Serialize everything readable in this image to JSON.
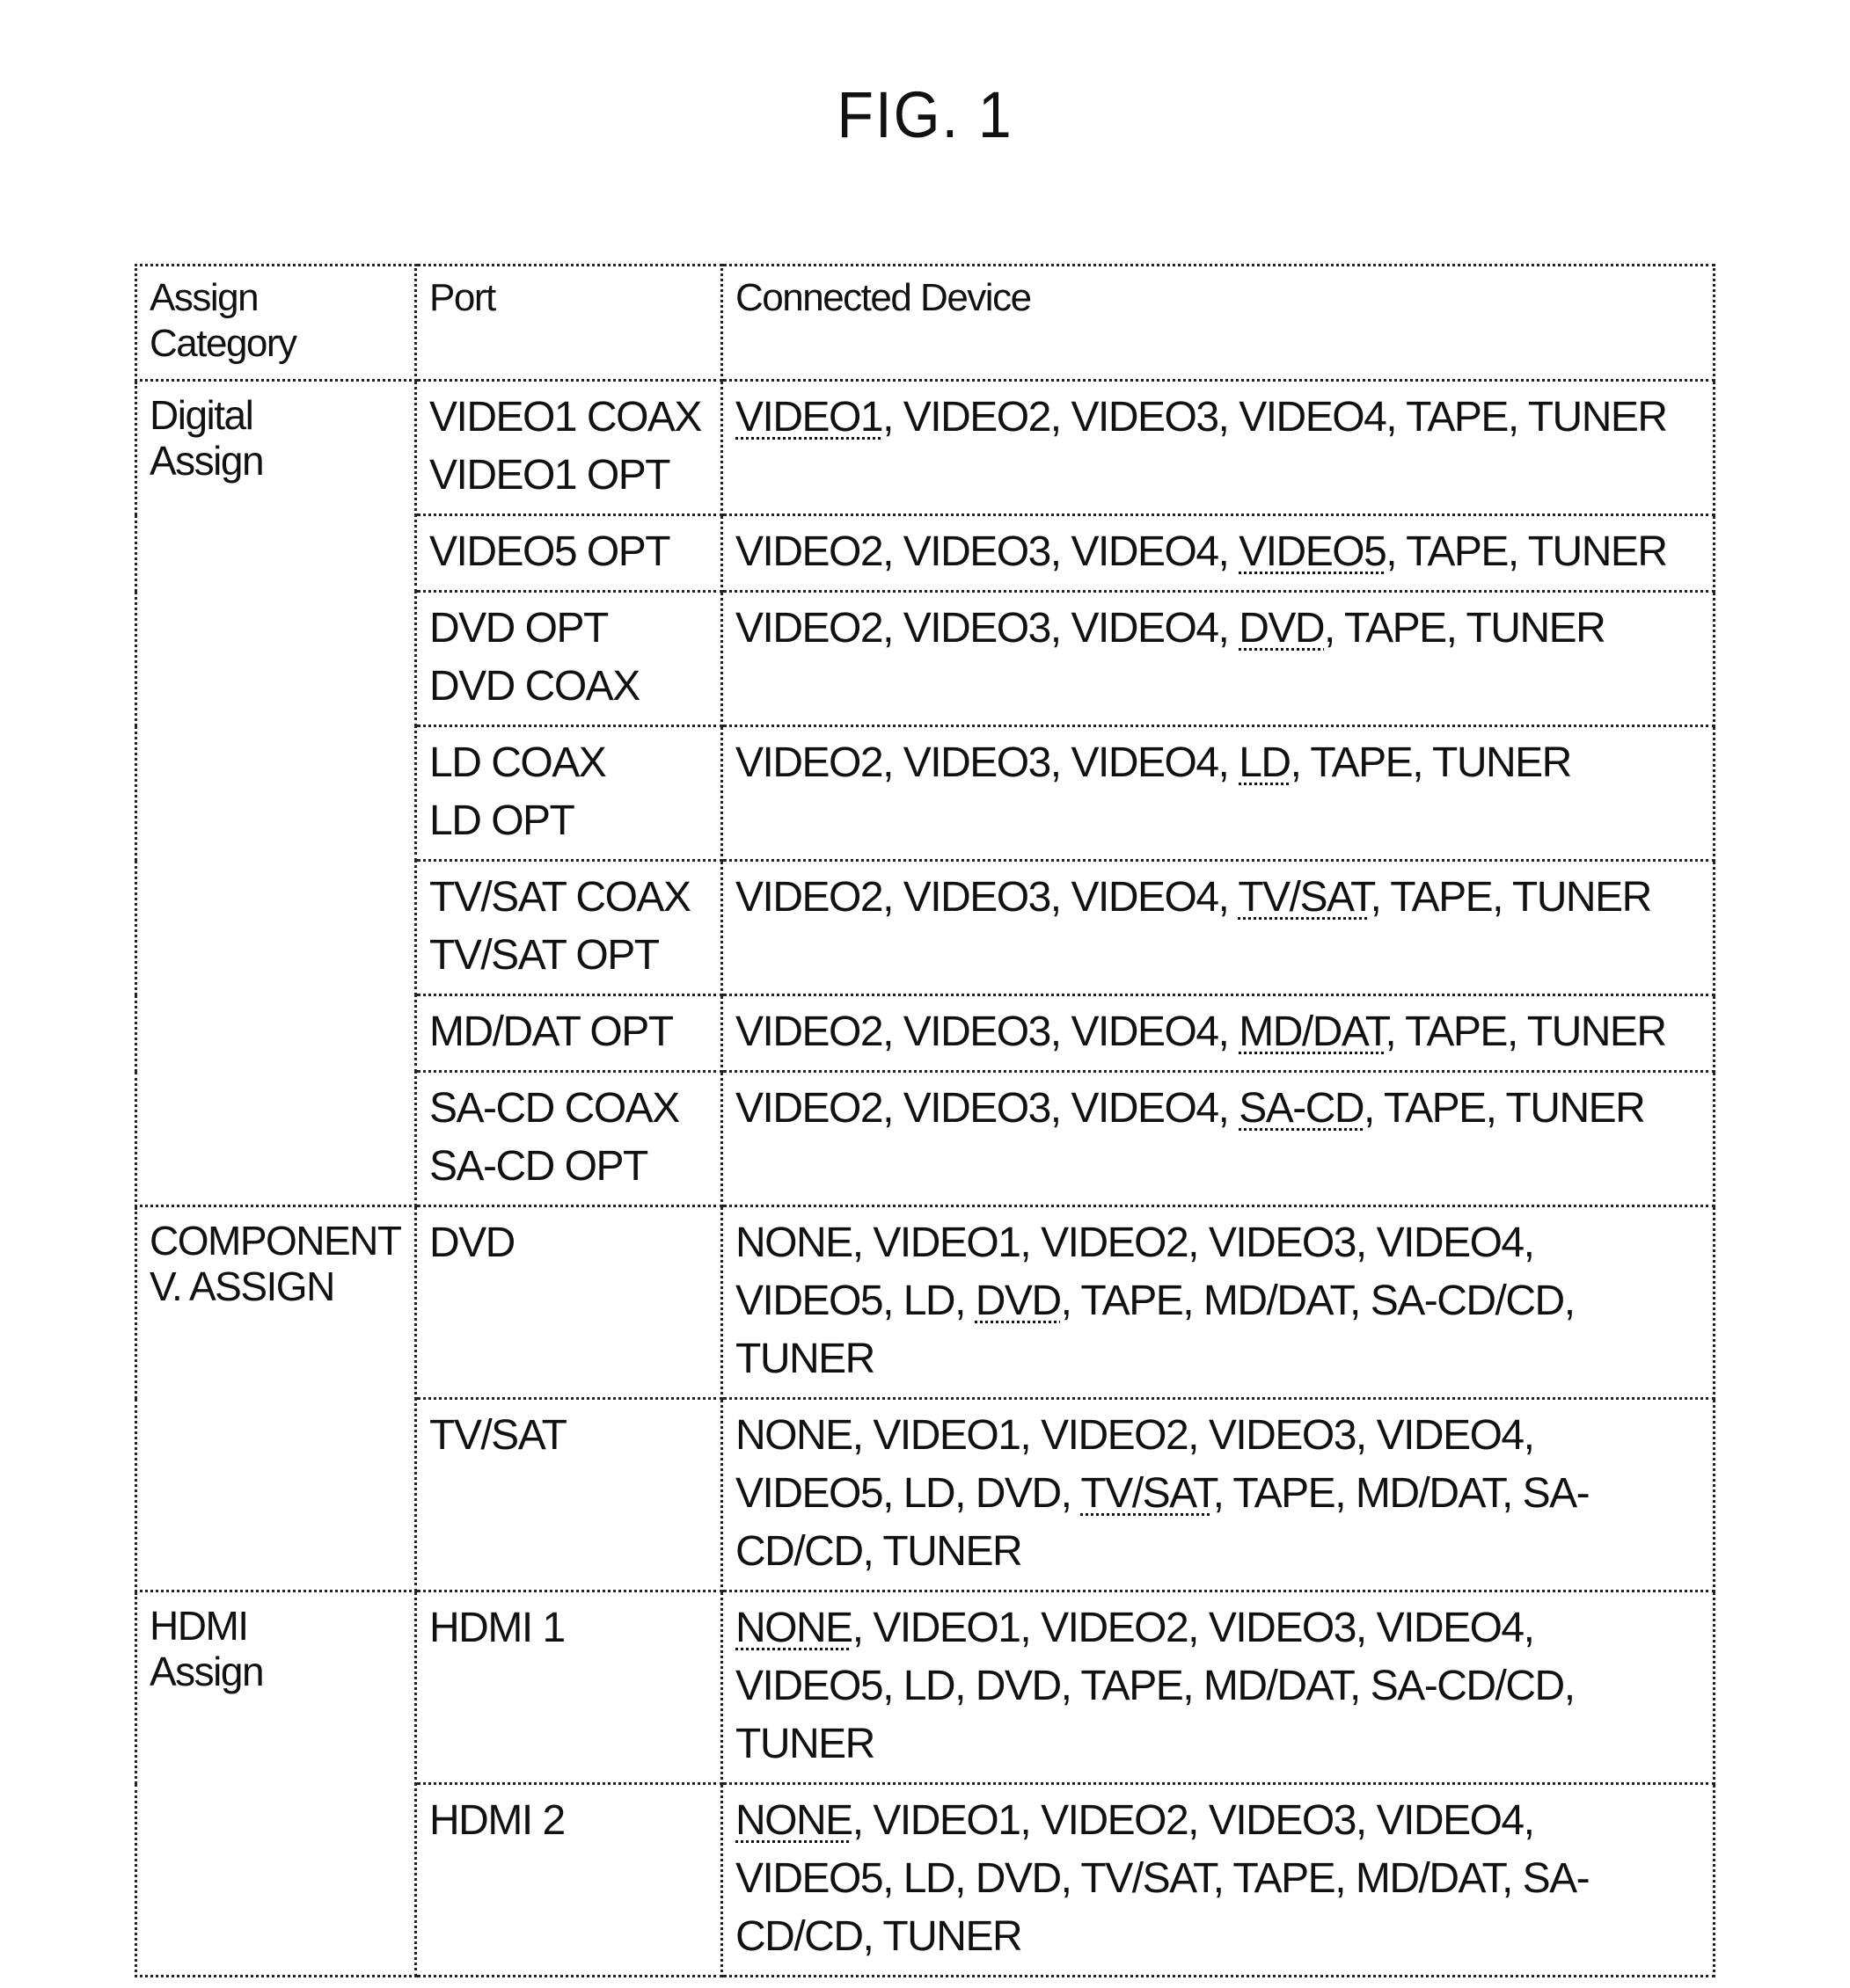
{
  "figure": {
    "title": "FIG. 1"
  },
  "table": {
    "headers": {
      "category_line1": "Assign",
      "category_line2": "Category",
      "port": "Port",
      "device": "Connected Device"
    },
    "groups": [
      {
        "category_lines": [
          "Digital",
          "Assign"
        ],
        "rows": [
          {
            "port_lines": [
              "VIDEO1 COAX",
              "VIDEO1 OPT"
            ],
            "devices": [
              "VIDEO1",
              "VIDEO2",
              "VIDEO3",
              "VIDEO4",
              "TAPE",
              "TUNER"
            ],
            "selected": "VIDEO1"
          },
          {
            "port_lines": [
              "VIDEO5 OPT"
            ],
            "devices": [
              "VIDEO2",
              "VIDEO3",
              "VIDEO4",
              "VIDEO5",
              "TAPE",
              "TUNER"
            ],
            "selected": "VIDEO5"
          },
          {
            "port_lines": [
              "DVD OPT",
              "DVD COAX"
            ],
            "devices": [
              "VIDEO2",
              "VIDEO3",
              "VIDEO4",
              "DVD",
              "TAPE",
              "TUNER"
            ],
            "selected": "DVD"
          },
          {
            "port_lines": [
              "LD COAX",
              "LD OPT"
            ],
            "devices": [
              "VIDEO2",
              "VIDEO3",
              "VIDEO4",
              "LD",
              "TAPE",
              "TUNER"
            ],
            "selected": "LD"
          },
          {
            "port_lines": [
              "TV/SAT COAX",
              "TV/SAT OPT"
            ],
            "devices": [
              "VIDEO2",
              "VIDEO3",
              "VIDEO4",
              "TV/SAT",
              "TAPE",
              "TUNER"
            ],
            "selected": "TV/SAT"
          },
          {
            "port_lines": [
              "MD/DAT OPT"
            ],
            "devices": [
              "VIDEO2",
              "VIDEO3",
              "VIDEO4",
              "MD/DAT",
              "TAPE",
              "TUNER"
            ],
            "selected": "MD/DAT"
          },
          {
            "port_lines": [
              "SA-CD COAX",
              "SA-CD OPT"
            ],
            "devices": [
              "VIDEO2",
              "VIDEO3",
              "VIDEO4",
              "SA-CD",
              "TAPE",
              "TUNER"
            ],
            "selected": "SA-CD"
          }
        ]
      },
      {
        "category_lines": [
          "COMPONENT",
          "V. ASSIGN"
        ],
        "rows": [
          {
            "port_lines": [
              "DVD"
            ],
            "devices": [
              "NONE",
              "VIDEO1",
              "VIDEO2",
              "VIDEO3",
              "VIDEO4",
              "VIDEO5",
              "LD",
              "DVD",
              "TAPE",
              "MD/DAT",
              "SA-CD/CD",
              "TUNER"
            ],
            "selected": "DVD"
          },
          {
            "port_lines": [
              "TV/SAT"
            ],
            "devices": [
              "NONE",
              "VIDEO1",
              "VIDEO2",
              "VIDEO3",
              "VIDEO4",
              "VIDEO5",
              "LD",
              "DVD",
              "TV/SAT",
              "TAPE",
              "MD/DAT",
              "SA-CD/CD",
              "TUNER"
            ],
            "selected": "TV/SAT"
          }
        ]
      },
      {
        "category_lines": [
          "HDMI",
          "Assign"
        ],
        "rows": [
          {
            "port_lines": [
              "HDMI 1"
            ],
            "devices": [
              "NONE",
              "VIDEO1",
              "VIDEO2",
              "VIDEO3",
              "VIDEO4",
              "VIDEO5",
              "LD",
              "DVD",
              "TAPE",
              "MD/DAT",
              "SA-CD/CD",
              "TUNER"
            ],
            "selected": "NONE"
          },
          {
            "port_lines": [
              "HDMI 2"
            ],
            "devices": [
              "NONE",
              "VIDEO1",
              "VIDEO2",
              "VIDEO3",
              "VIDEO4",
              "VIDEO5",
              "LD",
              "DVD",
              "TV/SAT",
              "TAPE",
              "MD/DAT",
              "SA-CD/CD",
              "TUNER"
            ],
            "selected": "NONE"
          }
        ]
      }
    ]
  }
}
